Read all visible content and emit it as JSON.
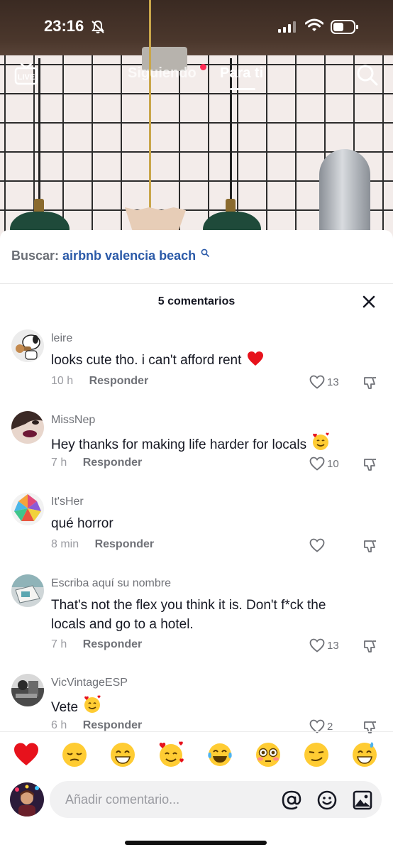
{
  "status_bar": {
    "time": "23:16"
  },
  "nav": {
    "tab_following": "Siguiendo",
    "tab_for_you": "Para ti",
    "live_label": "LIVE"
  },
  "sheet": {
    "search_prefix": "Buscar:",
    "search_query": "airbnb valencia beach",
    "title": "5 comentarios"
  },
  "comments": [
    {
      "user": "leire",
      "text": "looks cute tho. i can't afford rent",
      "emoji": "red-heart",
      "time": "10 h",
      "reply": "Responder",
      "likes": "13"
    },
    {
      "user": "MissNep",
      "text": "Hey thanks for making life harder for locals",
      "emoji": "smiling-face-with-hearts",
      "time": "7 h",
      "reply": "Responder",
      "likes": "10"
    },
    {
      "user": "It'sHer",
      "text": "qué horror",
      "time": "8 min",
      "reply": "Responder",
      "likes": ""
    },
    {
      "user": "Escriba aquí su nombre",
      "text": "That's not the flex you think it is. Don't f*ck the locals and go to a hotel.",
      "time": "7 h",
      "reply": "Responder",
      "likes": "13"
    },
    {
      "user": "VicVintageESP",
      "text": "Vete",
      "emoji": "smiling-face-with-hearts",
      "time": "6 h",
      "reply": "Responder",
      "likes": "2"
    }
  ],
  "emoji_bar": [
    "red-heart",
    "pensive-face",
    "grinning-face",
    "smiling-face-with-hearts",
    "tears-of-joy",
    "flushed-face",
    "smirking-face",
    "grinning-sweat-face"
  ],
  "input": {
    "placeholder": "Añadir comentario..."
  },
  "colors": {
    "accent_red": "#fe2c55",
    "link_blue": "#2b5aa8",
    "text": "#161823",
    "muted": "#6f7177"
  }
}
